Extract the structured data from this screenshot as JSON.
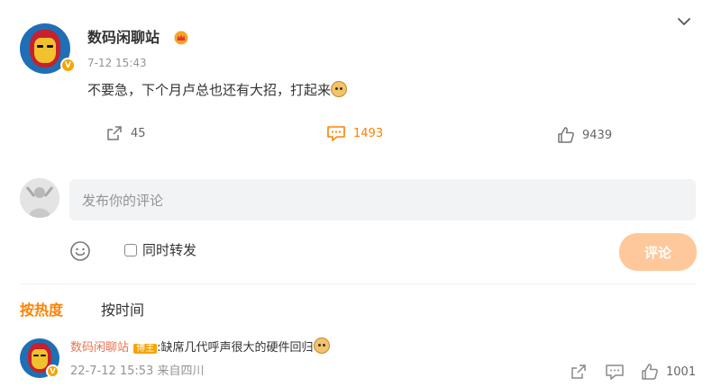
{
  "post": {
    "author": "数码闲聊站",
    "time": "7-12 15:43",
    "text": "不要急，下个月卢总也还有大招，打起来",
    "emoji": "doge-emoji",
    "actions": {
      "repost_count": "45",
      "comment_count": "1493",
      "like_count": "9439"
    }
  },
  "composer": {
    "placeholder": "发布你的评论",
    "repost_option": "同时转发",
    "submit_label": "评论"
  },
  "sort": {
    "hot": "按热度",
    "time": "按时间"
  },
  "reply": {
    "author": "数码闲聊站",
    "tag": "博主",
    "text": ":缺席几代呼声很大的硬件回归",
    "time_source": "22-7-12 15:53 来自四川",
    "like_count": "1001"
  },
  "colors": {
    "accent": "#ff8200",
    "reply_name": "#eb7350",
    "submit_disabled": "#ffc89b"
  }
}
